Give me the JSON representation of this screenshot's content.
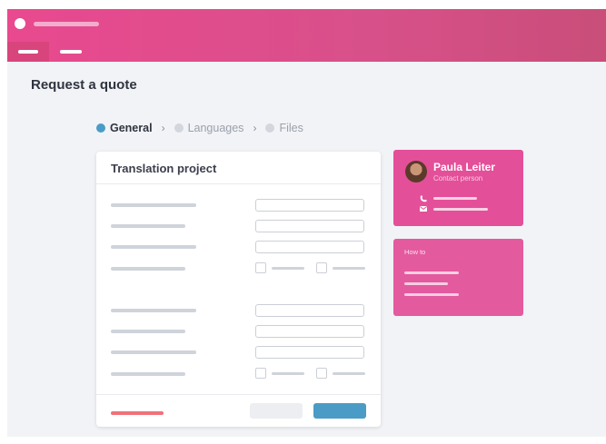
{
  "page": {
    "title": "Request a quote"
  },
  "stepper": {
    "steps": [
      {
        "label": "General",
        "active": true,
        "dot_color": "#4a9cc6"
      },
      {
        "label": "Languages",
        "active": false,
        "dot_color": "#d3d6dc"
      },
      {
        "label": "Files",
        "active": false,
        "dot_color": "#d3d6dc"
      }
    ],
    "separator": "›"
  },
  "form": {
    "title": "Translation project"
  },
  "contact": {
    "name": "Paula Leiter",
    "role": "Contact person",
    "phone_icon": "phone-icon",
    "email_icon": "email-icon"
  },
  "howto": {
    "title": "How to"
  },
  "colors": {
    "brand": "#e44f99",
    "accent": "#4a9cc6",
    "link": "#f0707a"
  }
}
